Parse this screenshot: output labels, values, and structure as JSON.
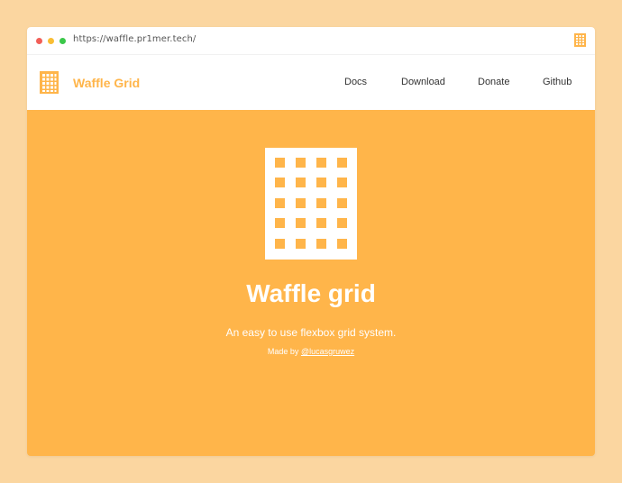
{
  "browser": {
    "url": "https://waffle.pr1mer.tech/"
  },
  "navbar": {
    "brand": "Waffle Grid",
    "links": [
      "Docs",
      "Download",
      "Donate",
      "Github"
    ]
  },
  "hero": {
    "title": "Waffle grid",
    "subtitle": "An easy to use flexbox grid system.",
    "credit_prefix": "Made by",
    "credit_author": "@lucasgruwez"
  },
  "colors": {
    "accent": "#FFB54A",
    "page_background": "#FBD6A0",
    "surface": "#FFFFFF"
  },
  "icons": {
    "logo": "waffle-grid-icon"
  }
}
